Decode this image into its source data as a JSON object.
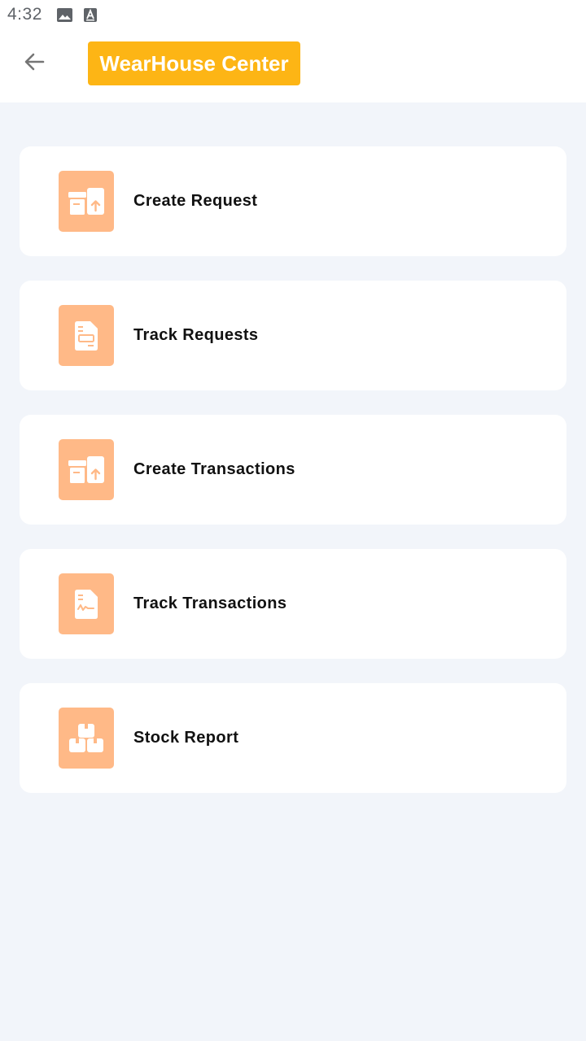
{
  "status_bar": {
    "time": "4:32",
    "icons": [
      "image-icon",
      "text-a-icon"
    ]
  },
  "app_bar": {
    "back_icon": "arrow-left-icon",
    "title": "WearHouse Center",
    "title_color": "#fdb515"
  },
  "menu": {
    "accent_color": "#ffb987",
    "items": [
      {
        "label": "Create Request",
        "icon": "box-upload-icon"
      },
      {
        "label": "Track Requests",
        "icon": "document-icon"
      },
      {
        "label": "Create Transactions",
        "icon": "box-upload-icon"
      },
      {
        "label": "Track Transactions",
        "icon": "document-signature-icon"
      },
      {
        "label": "Stock Report",
        "icon": "stacked-boxes-icon"
      }
    ]
  }
}
